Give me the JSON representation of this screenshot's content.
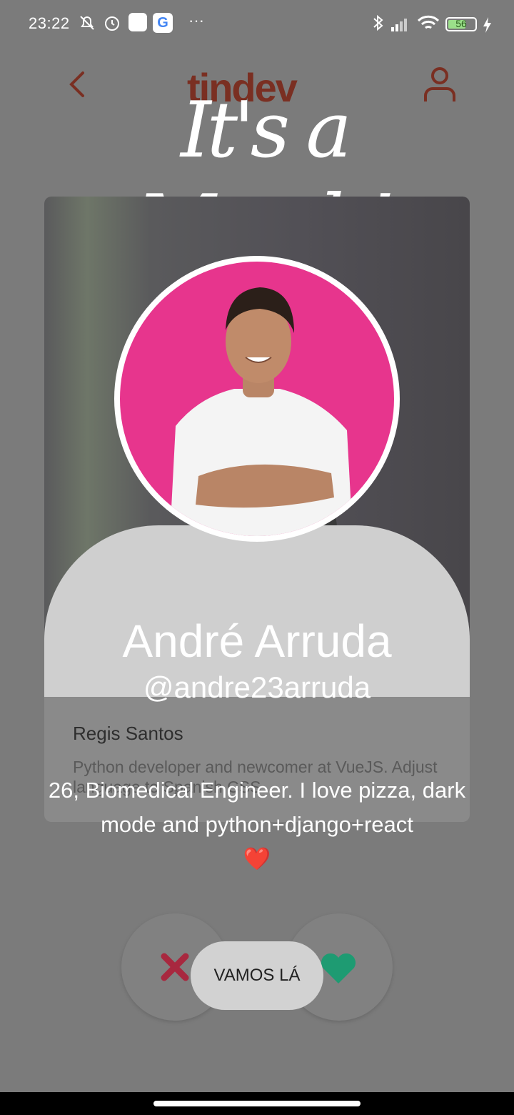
{
  "status_bar": {
    "time": "23:22",
    "icons": [
      "mute-bell-icon",
      "alarm-icon",
      "app-icon",
      "google-icon",
      "more-icon",
      "bluetooth-icon",
      "signal-icon",
      "wifi-icon",
      "battery-icon",
      "charging-icon"
    ],
    "google_letter": "G",
    "more": "···",
    "battery_level": "56"
  },
  "header": {
    "logo": "tindev"
  },
  "match": {
    "title": "It's a Match!"
  },
  "card": {
    "name": "Regis Santos",
    "bio": "Python developer and newcomer at VueJS. Adjust language to Spanish CSS"
  },
  "profile": {
    "name": "André Arruda",
    "handle": "@andre23arruda",
    "bio": "26, Biomedical Engineer. I love pizza, dark mode and python+django+react",
    "emoji": "❤️"
  },
  "actions": {
    "dislike_color": "#a8283f",
    "like_color": "#1e9b72",
    "cta_label": "VAMOS LÁ"
  },
  "colors": {
    "background": "#7b7b7b",
    "logo": "#7a2f22",
    "avatar_bg": "#e7358d"
  }
}
